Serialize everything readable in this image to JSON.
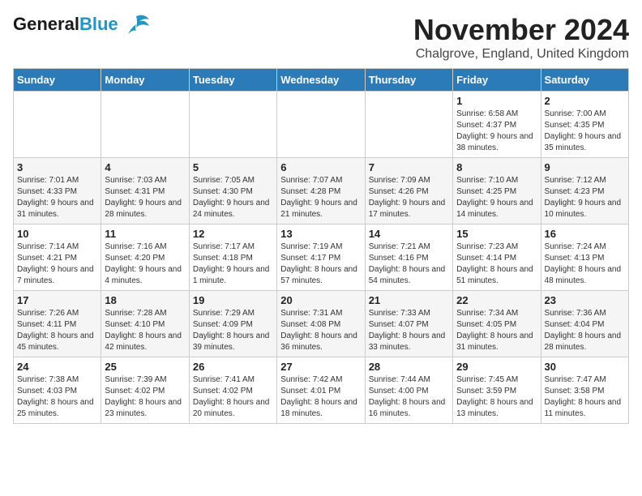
{
  "logo": {
    "line1": "General",
    "line2": "Blue"
  },
  "header": {
    "month": "November 2024",
    "location": "Chalgrove, England, United Kingdom"
  },
  "days_of_week": [
    "Sunday",
    "Monday",
    "Tuesday",
    "Wednesday",
    "Thursday",
    "Friday",
    "Saturday"
  ],
  "weeks": [
    [
      {
        "day": "",
        "info": ""
      },
      {
        "day": "",
        "info": ""
      },
      {
        "day": "",
        "info": ""
      },
      {
        "day": "",
        "info": ""
      },
      {
        "day": "",
        "info": ""
      },
      {
        "day": "1",
        "info": "Sunrise: 6:58 AM\nSunset: 4:37 PM\nDaylight: 9 hours and 38 minutes."
      },
      {
        "day": "2",
        "info": "Sunrise: 7:00 AM\nSunset: 4:35 PM\nDaylight: 9 hours and 35 minutes."
      }
    ],
    [
      {
        "day": "3",
        "info": "Sunrise: 7:01 AM\nSunset: 4:33 PM\nDaylight: 9 hours and 31 minutes."
      },
      {
        "day": "4",
        "info": "Sunrise: 7:03 AM\nSunset: 4:31 PM\nDaylight: 9 hours and 28 minutes."
      },
      {
        "day": "5",
        "info": "Sunrise: 7:05 AM\nSunset: 4:30 PM\nDaylight: 9 hours and 24 minutes."
      },
      {
        "day": "6",
        "info": "Sunrise: 7:07 AM\nSunset: 4:28 PM\nDaylight: 9 hours and 21 minutes."
      },
      {
        "day": "7",
        "info": "Sunrise: 7:09 AM\nSunset: 4:26 PM\nDaylight: 9 hours and 17 minutes."
      },
      {
        "day": "8",
        "info": "Sunrise: 7:10 AM\nSunset: 4:25 PM\nDaylight: 9 hours and 14 minutes."
      },
      {
        "day": "9",
        "info": "Sunrise: 7:12 AM\nSunset: 4:23 PM\nDaylight: 9 hours and 10 minutes."
      }
    ],
    [
      {
        "day": "10",
        "info": "Sunrise: 7:14 AM\nSunset: 4:21 PM\nDaylight: 9 hours and 7 minutes."
      },
      {
        "day": "11",
        "info": "Sunrise: 7:16 AM\nSunset: 4:20 PM\nDaylight: 9 hours and 4 minutes."
      },
      {
        "day": "12",
        "info": "Sunrise: 7:17 AM\nSunset: 4:18 PM\nDaylight: 9 hours and 1 minute."
      },
      {
        "day": "13",
        "info": "Sunrise: 7:19 AM\nSunset: 4:17 PM\nDaylight: 8 hours and 57 minutes."
      },
      {
        "day": "14",
        "info": "Sunrise: 7:21 AM\nSunset: 4:16 PM\nDaylight: 8 hours and 54 minutes."
      },
      {
        "day": "15",
        "info": "Sunrise: 7:23 AM\nSunset: 4:14 PM\nDaylight: 8 hours and 51 minutes."
      },
      {
        "day": "16",
        "info": "Sunrise: 7:24 AM\nSunset: 4:13 PM\nDaylight: 8 hours and 48 minutes."
      }
    ],
    [
      {
        "day": "17",
        "info": "Sunrise: 7:26 AM\nSunset: 4:11 PM\nDaylight: 8 hours and 45 minutes."
      },
      {
        "day": "18",
        "info": "Sunrise: 7:28 AM\nSunset: 4:10 PM\nDaylight: 8 hours and 42 minutes."
      },
      {
        "day": "19",
        "info": "Sunrise: 7:29 AM\nSunset: 4:09 PM\nDaylight: 8 hours and 39 minutes."
      },
      {
        "day": "20",
        "info": "Sunrise: 7:31 AM\nSunset: 4:08 PM\nDaylight: 8 hours and 36 minutes."
      },
      {
        "day": "21",
        "info": "Sunrise: 7:33 AM\nSunset: 4:07 PM\nDaylight: 8 hours and 33 minutes."
      },
      {
        "day": "22",
        "info": "Sunrise: 7:34 AM\nSunset: 4:05 PM\nDaylight: 8 hours and 31 minutes."
      },
      {
        "day": "23",
        "info": "Sunrise: 7:36 AM\nSunset: 4:04 PM\nDaylight: 8 hours and 28 minutes."
      }
    ],
    [
      {
        "day": "24",
        "info": "Sunrise: 7:38 AM\nSunset: 4:03 PM\nDaylight: 8 hours and 25 minutes."
      },
      {
        "day": "25",
        "info": "Sunrise: 7:39 AM\nSunset: 4:02 PM\nDaylight: 8 hours and 23 minutes."
      },
      {
        "day": "26",
        "info": "Sunrise: 7:41 AM\nSunset: 4:02 PM\nDaylight: 8 hours and 20 minutes."
      },
      {
        "day": "27",
        "info": "Sunrise: 7:42 AM\nSunset: 4:01 PM\nDaylight: 8 hours and 18 minutes."
      },
      {
        "day": "28",
        "info": "Sunrise: 7:44 AM\nSunset: 4:00 PM\nDaylight: 8 hours and 16 minutes."
      },
      {
        "day": "29",
        "info": "Sunrise: 7:45 AM\nSunset: 3:59 PM\nDaylight: 8 hours and 13 minutes."
      },
      {
        "day": "30",
        "info": "Sunrise: 7:47 AM\nSunset: 3:58 PM\nDaylight: 8 hours and 11 minutes."
      }
    ]
  ]
}
